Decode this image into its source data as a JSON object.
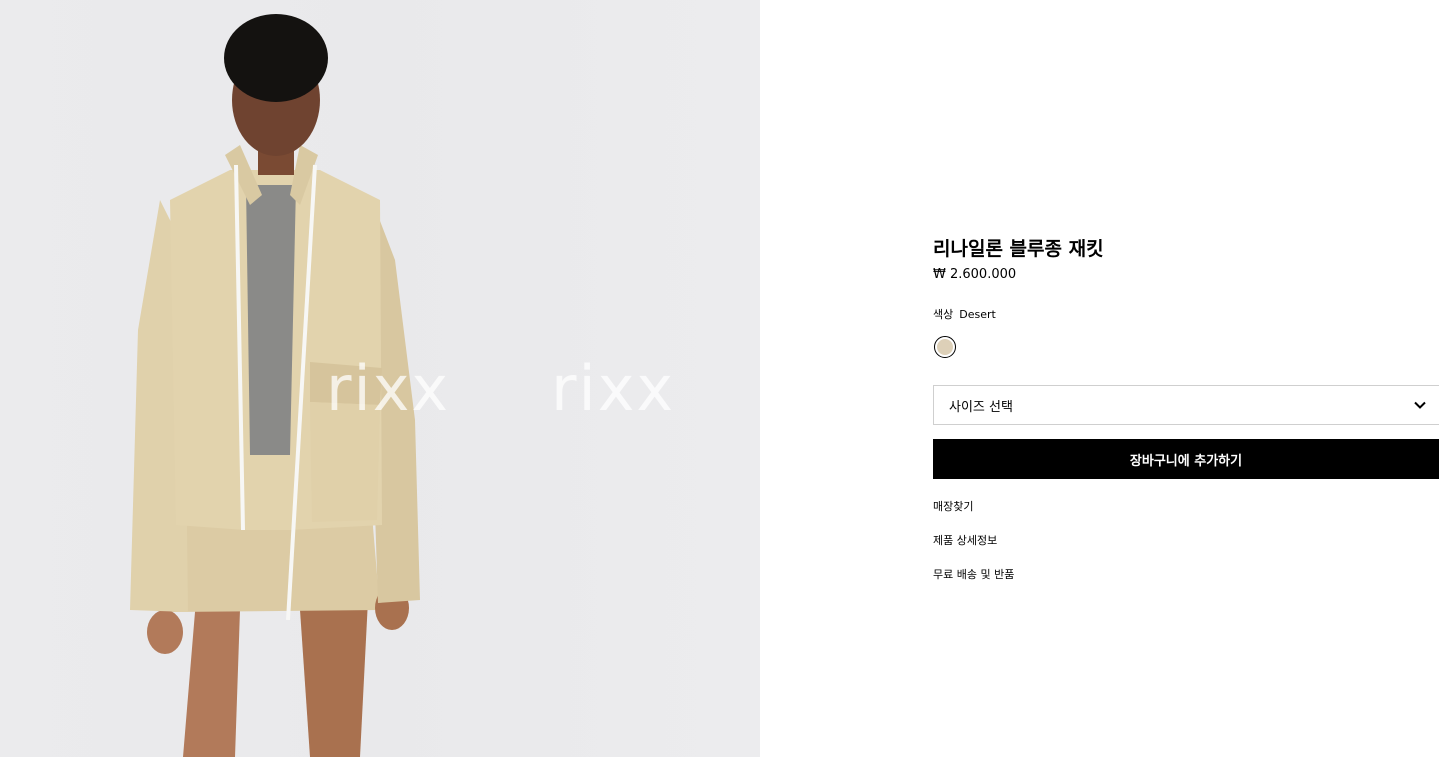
{
  "product": {
    "title": "리나일론 블루종 재킷",
    "price": "₩ 2.600.000",
    "color_label": "색상",
    "color_value": "Desert",
    "swatch_color": "#ddd0b8",
    "size_placeholder": "사이즈 선택",
    "add_to_cart_label": "장바구니에 추가하기"
  },
  "links": [
    "매장찾기",
    "제품 상세정보",
    "무료 배송 및 반품"
  ],
  "image": {
    "watermarks": [
      "rixx",
      "rixx"
    ]
  },
  "colors": {
    "jacket": "#e2d3ad",
    "background": "#ebebed",
    "button": "#000000"
  }
}
